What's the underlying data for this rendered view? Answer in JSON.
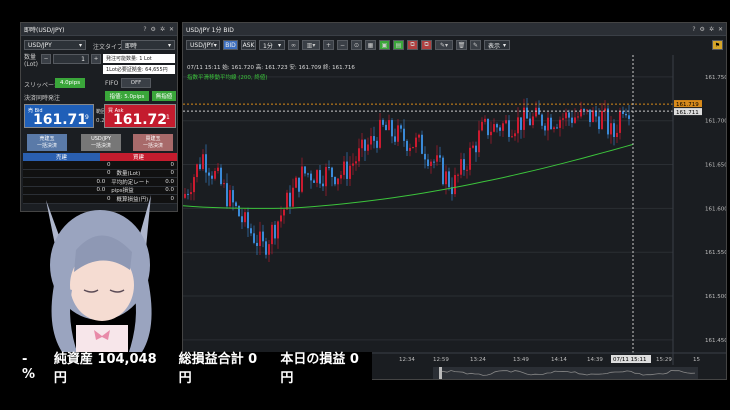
{
  "order": {
    "title": "即時(USD/JPY)",
    "symbol": "USD/JPY",
    "order_type_label": "注文タイプ",
    "order_type": "即時",
    "qty_label": "数量\n(Lot)",
    "qty_minus": "−",
    "qty_value": "1",
    "qty_plus": "+",
    "max_lot": "発注可能数量: 1 Lot",
    "required_margin": "1Lot必要証拠金: 64,655円",
    "slippage_label": "スリッページ",
    "slippage_value": "4.0pips",
    "fifo_label": "FIFO",
    "fifo_value": "OFF",
    "close_label": "決済同時発注",
    "close_btn": "指値: 5.0pips",
    "close_btn2": "無指値",
    "bid_label": "売 Bid",
    "bid_big": "161.71",
    "bid_small": "9",
    "spread_label": "範囲",
    "spread": "0.2",
    "ask_label": "買 Ask",
    "ask_big": "161.72",
    "ask_small": "1",
    "sell_close": "売建玉\n一括決済",
    "all_close": "USD/JPY\n一括決済",
    "buy_close": "買建玉\n一括決済",
    "sell_head": "売建",
    "buy_head": "買建",
    "rows": [
      {
        "left": "0",
        "label": "",
        "right": "0"
      },
      {
        "left": "0",
        "label": "数量(Lot)",
        "right": "0"
      },
      {
        "left": "0.0",
        "label": "平均約定レート",
        "right": "0.0"
      },
      {
        "left": "0.0",
        "label": "pips損益",
        "right": "0.0"
      },
      {
        "left": "0",
        "label": "概算損益(円)",
        "right": "0"
      }
    ]
  },
  "chart": {
    "title": "USD/JPY 1分 BID",
    "symbol": "USD/JPY",
    "bid_btn": "BID",
    "ask_btn": "ASK",
    "timeframe": "1分",
    "display_btn": "表示",
    "ohlc": "07/11 15:11 始: 161.720 高: 161.723 安: 161.709 終: 161.716",
    "indicator": "指数平滑移動平均線 (200, 終値)",
    "current_price": "161.719",
    "line_price": "161.711",
    "crosshair_time": "07/11 15:11",
    "y_ticks": [
      "161.750",
      "161.700",
      "161.650",
      "161.600",
      "161.550",
      "161.500",
      "161.450"
    ],
    "x_ticks": [
      "12:34",
      "12:59",
      "13:24",
      "13:49",
      "14:14",
      "14:39",
      "15:29",
      "15"
    ],
    "colors": {
      "up": "#cc1a2f",
      "down": "#3a8ad8",
      "ma": "#3cc43c",
      "crosshair": "#d88a1a"
    }
  },
  "footer": {
    "pct": "- %",
    "net_assets": "純資産 104,048 円",
    "total_pnl": "総損益合計 0 円",
    "today_pnl": "本日の損益 0 円"
  }
}
